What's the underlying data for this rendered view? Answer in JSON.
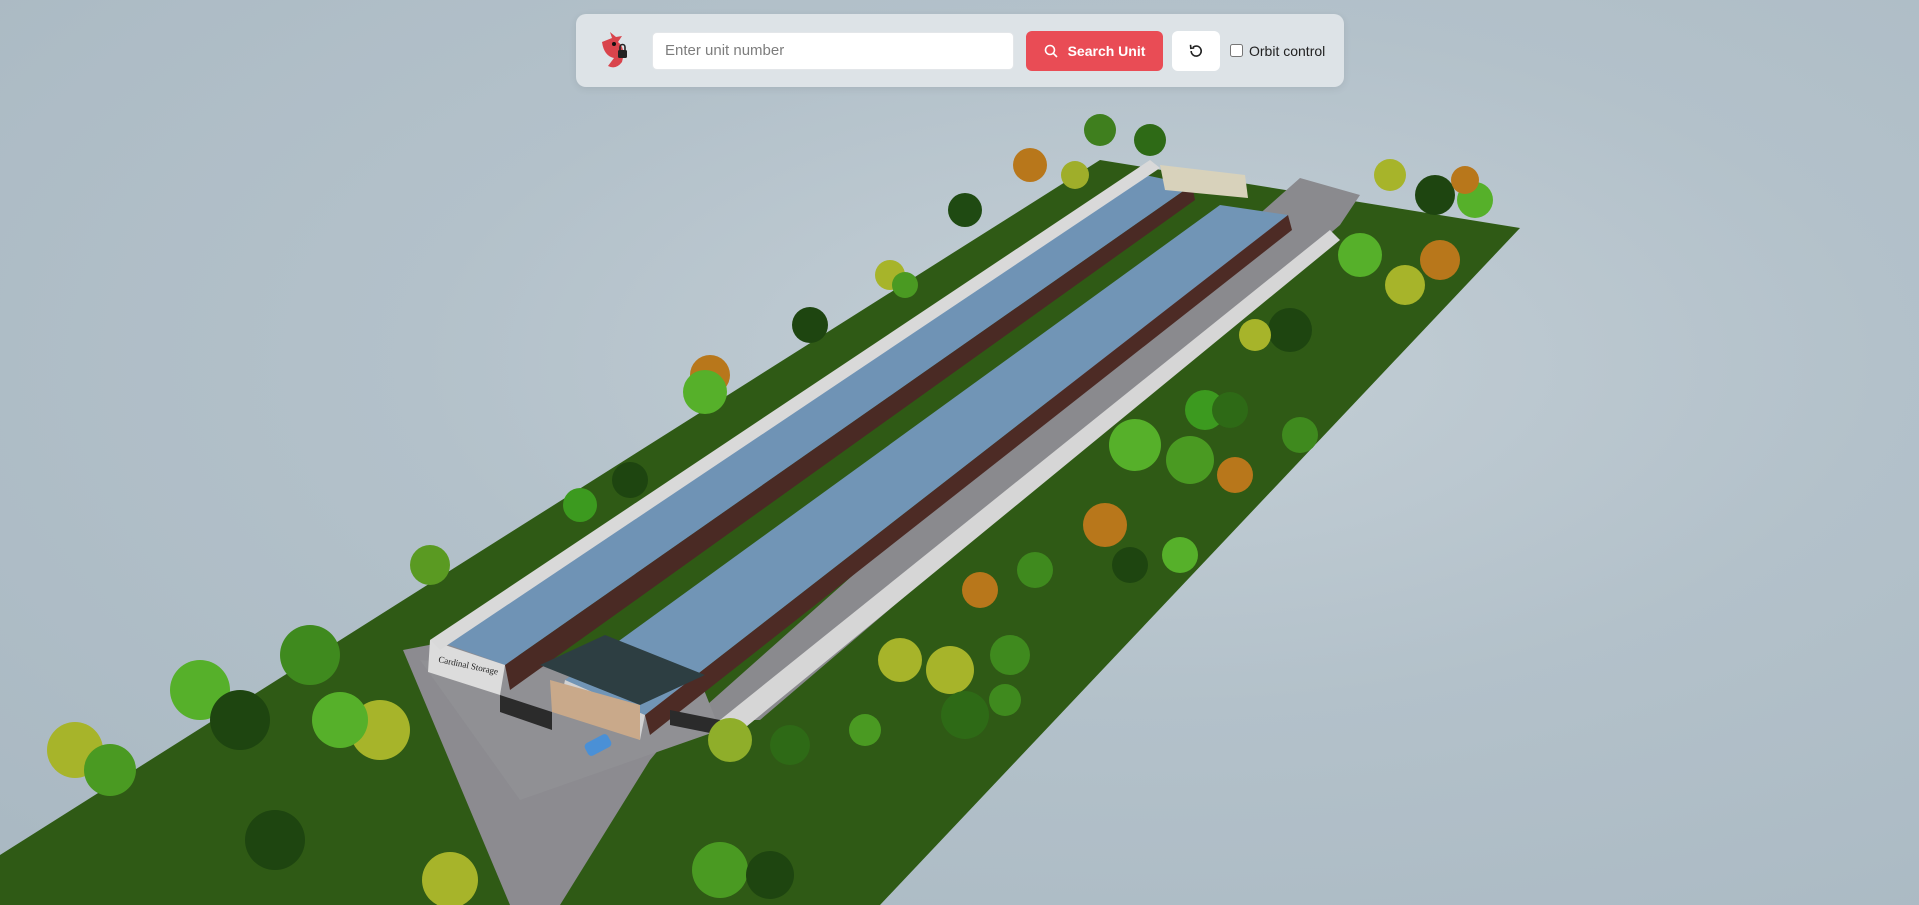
{
  "toolbar": {
    "logo_icon": "cardinal-lock-logo",
    "search_placeholder": "Enter unit number",
    "search_value": "",
    "search_button_label": "Search Unit",
    "search_icon": "search-icon",
    "reset_icon": "refresh-icon",
    "orbit_label": "Orbit control",
    "orbit_checked": false
  },
  "scene": {
    "sign_text": "Cardinal Storage",
    "colors": {
      "sky": "#b3c1ca",
      "grass": "#2f5a15",
      "pavement": "#8a8a8e",
      "roof": "#6f93b5",
      "wall": "#d6d6d6",
      "door": "#5a2e25",
      "accent": "#e94c55"
    }
  }
}
